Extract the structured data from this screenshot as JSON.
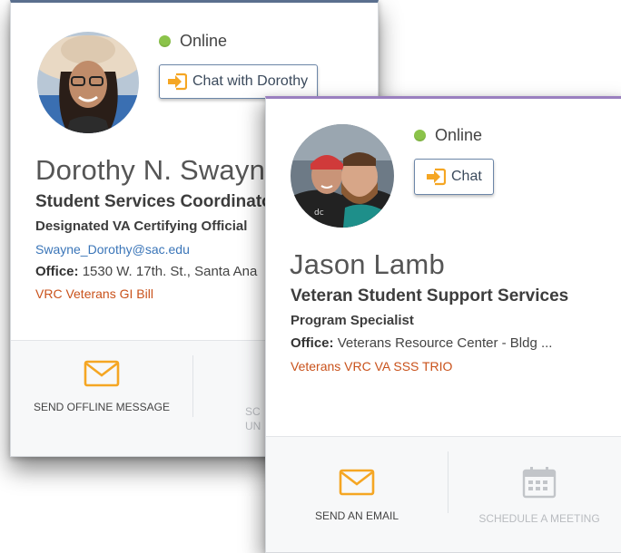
{
  "dorothy": {
    "status": "Online",
    "chat_label": "Chat with Dorothy",
    "name": "Dorothy N. Swayne",
    "title": "Student Services Coordinator",
    "subtitle": "Designated VA Certifying Official",
    "email": "Swayne_Dorothy@sac.edu",
    "office_label": "Office:",
    "office_value": "1530 W. 17th. St., Santa Ana",
    "tags": "VRC Veterans GI Bill",
    "actions": {
      "offline_message": "SEND OFFLINE MESSAGE",
      "schedule_partial_1": "SC",
      "schedule_partial_2": "UN"
    }
  },
  "jason": {
    "status": "Online",
    "chat_label": "Chat",
    "name": "Jason Lamb",
    "title": "Veteran Student Support Services",
    "subtitle": "Program Specialist",
    "office_label": "Office:",
    "office_value": "Veterans Resource Center - Bldg ...",
    "tags": "Veterans VRC VA SSS TRIO",
    "actions": {
      "email": "SEND AN EMAIL",
      "schedule": "SCHEDULE A MEETING"
    }
  },
  "colors": {
    "online": "#8bc34a",
    "accent_orange": "#f5a623",
    "tag_orange": "#c9521b",
    "email_blue": "#3a75b8"
  },
  "icons": {
    "chat": "arrow-into-box-icon",
    "mail": "envelope-icon",
    "calendar": "calendar-icon"
  }
}
